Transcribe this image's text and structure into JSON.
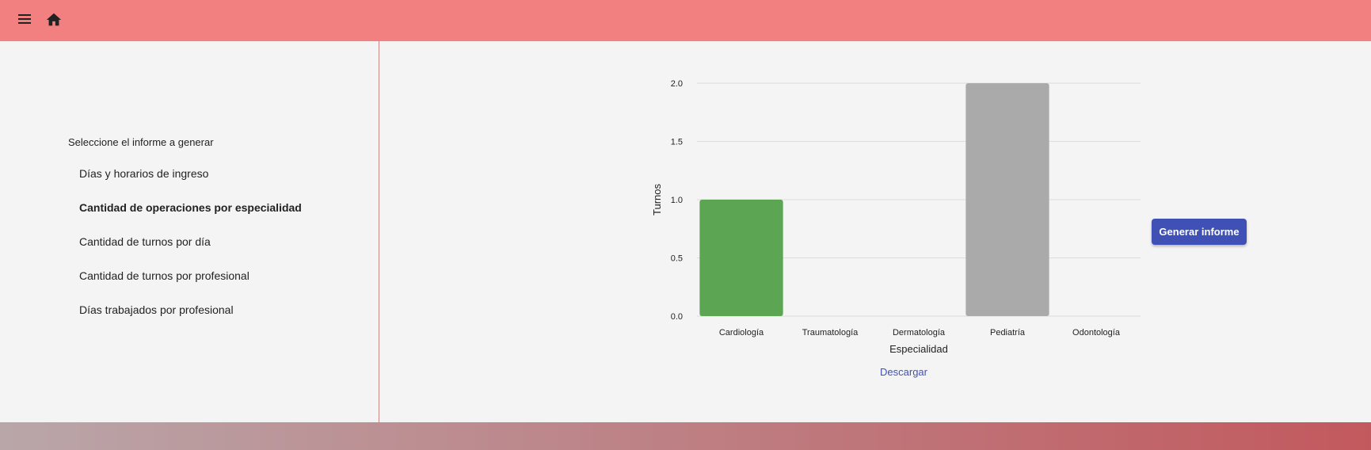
{
  "header": {
    "menu_icon": "menu-icon",
    "home_icon": "home-icon",
    "bar_color": "#f28080"
  },
  "sidebar": {
    "title": "Seleccione el informe a generar",
    "items": [
      {
        "label": "Días y horarios de ingreso",
        "active": false
      },
      {
        "label": "Cantidad de operaciones por especialidad",
        "active": true
      },
      {
        "label": "Cantidad de turnos por día",
        "active": false
      },
      {
        "label": "Cantidad de turnos por profesional",
        "active": false
      },
      {
        "label": "Días trabajados por profesional",
        "active": false
      }
    ]
  },
  "chart_data": {
    "type": "bar",
    "categories": [
      "Cardiología",
      "Traumatología",
      "Dermatología",
      "Pediatría",
      "Odontología"
    ],
    "values": [
      1,
      0,
      0,
      2,
      0
    ],
    "colors": [
      "#5ba553",
      "#aaaaaa",
      "#aaaaaa",
      "#aaaaaa",
      "#aaaaaa"
    ],
    "title": "",
    "xlabel": "Especialidad",
    "ylabel": "Turnos",
    "ylim": [
      0,
      2
    ],
    "yticks": [
      "0.0",
      "0.5",
      "1.0",
      "1.5",
      "2.0"
    ],
    "grid": true
  },
  "actions": {
    "download_label": "Descargar",
    "generate_label": "Generar informe",
    "accent_color": "#3f51b5"
  }
}
